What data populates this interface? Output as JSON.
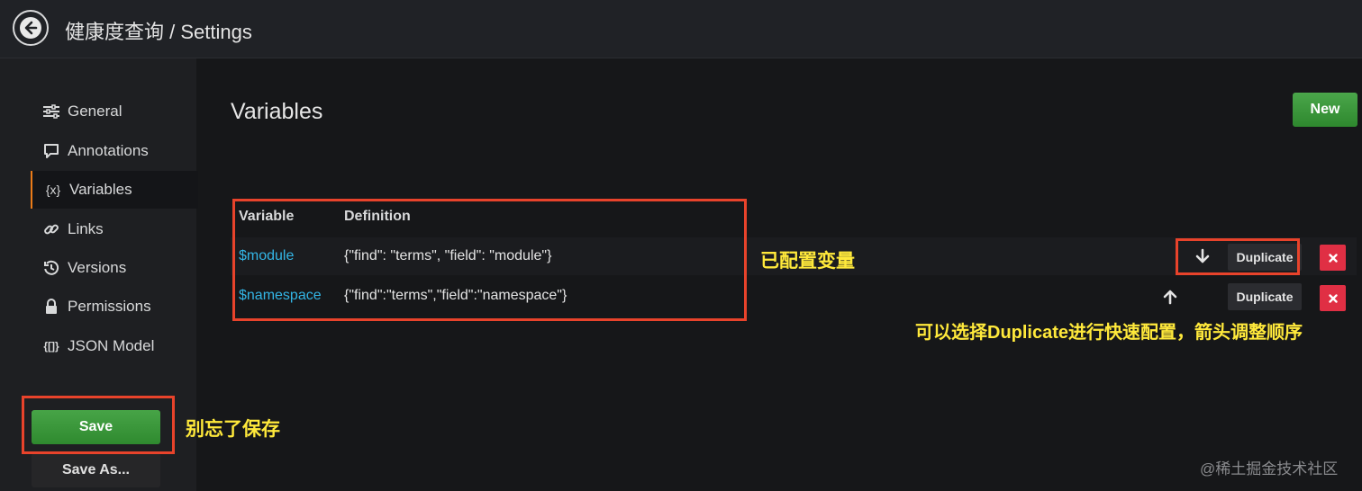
{
  "header": {
    "title": "健康度查询 / Settings"
  },
  "sidebar": {
    "items": [
      {
        "label": "General",
        "icon": "sliders-icon"
      },
      {
        "label": "Annotations",
        "icon": "comment-icon"
      },
      {
        "label": "Variables",
        "icon": "variable-icon",
        "icon_text": "{x}"
      },
      {
        "label": "Links",
        "icon": "link-icon"
      },
      {
        "label": "Versions",
        "icon": "history-icon"
      },
      {
        "label": "Permissions",
        "icon": "lock-icon"
      },
      {
        "label": "JSON Model",
        "icon": "json-icon",
        "icon_text": "{[]}"
      }
    ],
    "save_label": "Save",
    "save_as_label": "Save As..."
  },
  "main": {
    "title": "Variables",
    "new_label": "New",
    "table": {
      "headers": [
        "Variable",
        "Definition"
      ],
      "rows": [
        {
          "name": "$module",
          "definition": "{\"find\": \"terms\", \"field\": \"module\"}"
        },
        {
          "name": "$namespace",
          "definition": "{\"find\":\"terms\",\"field\":\"namespace\"}"
        }
      ],
      "duplicate_label": "Duplicate"
    }
  },
  "annotations": {
    "configured": "已配置变量",
    "duplicate_hint": "可以选择Duplicate进行快速配置，箭头调整顺序",
    "save_hint": "别忘了保存"
  },
  "watermark": "@稀土掘金技术社区",
  "colors": {
    "accent_orange": "#eb7b18",
    "success_green": "#3d963d",
    "danger_red": "#e02f44",
    "link_blue": "#33b5e5",
    "annotation_yellow": "#ffe93b",
    "highlight_red": "#e8432b"
  }
}
